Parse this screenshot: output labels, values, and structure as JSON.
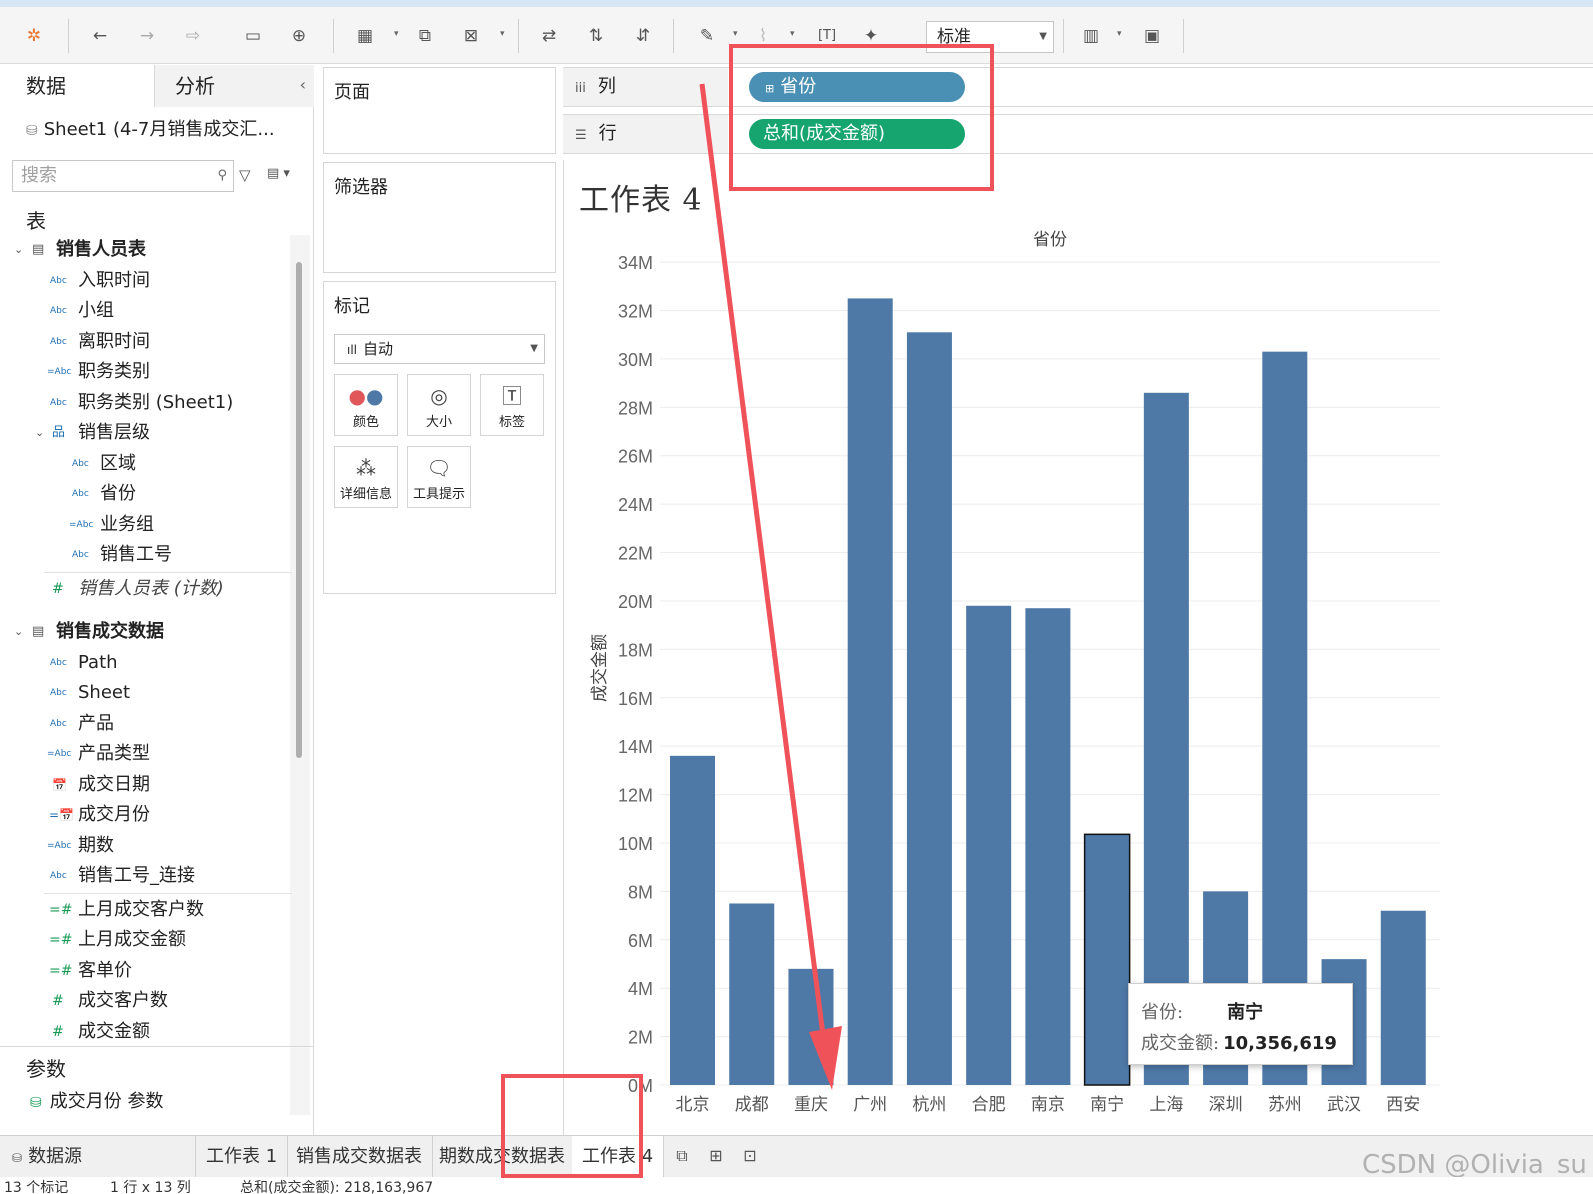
{
  "toolbar": {
    "fit_mode": "标准",
    "icons": [
      "tableau-logo-icon",
      "undo-icon",
      "redo-icon",
      "replay-icon",
      "save-icon",
      "new-datasource-icon",
      "new-worksheet-icon",
      "duplicate-sheet-icon",
      "clear-sheet-icon",
      "swap-axes-icon",
      "sort-ascending-icon",
      "sort-descending-icon",
      "highlight-icon",
      "group-icon",
      "label-icon",
      "pin-icon",
      "show-cards-icon",
      "presentation-icon"
    ]
  },
  "left_pane": {
    "tab_data": "数据",
    "tab_analysis": "分析",
    "datasource": "Sheet1 (4-7月销售成交汇...",
    "search_placeholder": "搜索",
    "section_tables": "表",
    "tables": [
      {
        "name": "销售人员表",
        "fields": [
          {
            "type": "Abc",
            "name": "入职时间"
          },
          {
            "type": "Abc",
            "name": "小组"
          },
          {
            "type": "Abc",
            "name": "离职时间"
          },
          {
            "type": "=Abc",
            "name": "职务类别"
          },
          {
            "type": "Abc",
            "name": "职务类别 (Sheet1)"
          }
        ],
        "hierarchy": {
          "name": "销售层级",
          "fields": [
            {
              "type": "Abc",
              "name": "区域"
            },
            {
              "type": "Abc",
              "name": "省份"
            },
            {
              "type": "=Abc",
              "name": "业务组"
            },
            {
              "type": "Abc",
              "name": "销售工号"
            }
          ]
        },
        "count_field": "销售人员表 (计数)"
      },
      {
        "name": "销售成交数据",
        "fields": [
          {
            "type": "Abc",
            "name": "Path"
          },
          {
            "type": "Abc",
            "name": "Sheet"
          },
          {
            "type": "Abc",
            "name": "产品"
          },
          {
            "type": "=Abc",
            "name": "产品类型"
          },
          {
            "type": "date",
            "name": "成交日期"
          },
          {
            "type": "=date",
            "name": "成交月份"
          },
          {
            "type": "=Abc",
            "name": "期数"
          },
          {
            "type": "Abc",
            "name": "销售工号_连接"
          }
        ],
        "measures": [
          {
            "type": "=#",
            "name": "上月成交客户数"
          },
          {
            "type": "=#",
            "name": "上月成交金额"
          },
          {
            "type": "=#",
            "name": "客单价"
          },
          {
            "type": "#",
            "name": "成交客户数"
          },
          {
            "type": "#",
            "name": "成交金额"
          }
        ]
      }
    ],
    "section_params": "参数",
    "params": [
      "成交月份 参数"
    ]
  },
  "cards": {
    "pages": "页面",
    "filters": "筛选器",
    "marks": "标记",
    "mark_type": "自动",
    "mark_buttons": [
      {
        "label": "颜色",
        "icon": "color-icon"
      },
      {
        "label": "大小",
        "icon": "size-icon"
      },
      {
        "label": "标签",
        "icon": "label-icon"
      },
      {
        "label": "详细信息",
        "icon": "detail-icon"
      },
      {
        "label": "工具提示",
        "icon": "tooltip-icon"
      }
    ]
  },
  "shelves": {
    "columns_label": "列",
    "rows_label": "行",
    "columns_pill": "省份",
    "rows_pill": "总和(成交金额)"
  },
  "viz": {
    "title": "工作表 4"
  },
  "chart_data": {
    "type": "bar",
    "title": "工作表 4",
    "xlabel": "省份",
    "ylabel": "成交金额",
    "categories": [
      "北京",
      "成都",
      "重庆",
      "广州",
      "杭州",
      "合肥",
      "南京",
      "南宁",
      "上海",
      "深圳",
      "苏州",
      "武汉",
      "西安"
    ],
    "values": [
      13600000,
      7500000,
      4800000,
      32500000,
      31100000,
      19800000,
      19700000,
      10356619,
      28600000,
      8000000,
      30300000,
      5200000,
      7200000
    ],
    "y_ticks": [
      "0M",
      "2M",
      "4M",
      "6M",
      "8M",
      "10M",
      "12M",
      "14M",
      "16M",
      "18M",
      "20M",
      "22M",
      "24M",
      "26M",
      "28M",
      "30M",
      "32M",
      "34M"
    ],
    "ylim": [
      0,
      34500000
    ],
    "color": "#4e79a7",
    "highlighted": "南宁",
    "grid": true
  },
  "tooltip": {
    "k1": "省份:",
    "v1": "南宁",
    "k2": "成交金额:",
    "v2": "10,356,619"
  },
  "bottom": {
    "datasource_tab": "数据源",
    "sheets": [
      "工作表 1",
      "销售成交数据表",
      "期数成交数据表",
      "工作表 4"
    ],
    "active_sheet": "工作表 4"
  },
  "status": {
    "marks": "13 个标记",
    "dims": "1 行 x 13 列",
    "sum": "总和(成交金额): 218,163,967"
  },
  "watermark": "CSDN @Olivia_su"
}
